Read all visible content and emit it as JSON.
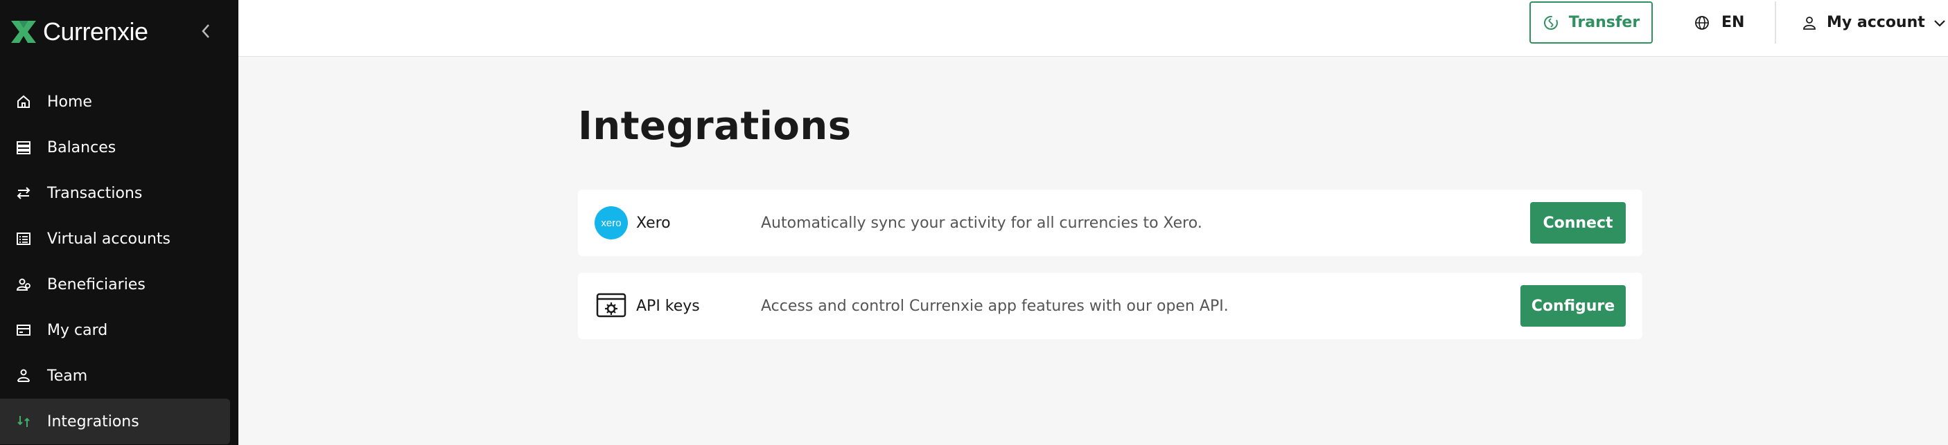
{
  "app": {
    "brand": "Currenxie",
    "colors": {
      "accent": "#2f9060",
      "sidebar": "#111111",
      "xero": "#13b5ea"
    }
  },
  "sidebar": {
    "collapse_icon": "chevron-left-icon",
    "items": [
      {
        "label": "Home",
        "icon": "home-icon",
        "active": false
      },
      {
        "label": "Balances",
        "icon": "balances-icon",
        "active": false
      },
      {
        "label": "Transactions",
        "icon": "transactions-icon",
        "active": false
      },
      {
        "label": "Virtual accounts",
        "icon": "virtual-accounts-icon",
        "active": false
      },
      {
        "label": "Beneficiaries",
        "icon": "beneficiaries-icon",
        "active": false
      },
      {
        "label": "My card",
        "icon": "card-icon",
        "active": false
      },
      {
        "label": "Team",
        "icon": "team-icon",
        "active": false
      },
      {
        "label": "Integrations",
        "icon": "integrations-icon",
        "active": true
      }
    ]
  },
  "topbar": {
    "transfer_label": "Transfer",
    "language": "EN",
    "account_label": "My account"
  },
  "main": {
    "title": "Integrations",
    "integrations": [
      {
        "logo_text": "xero",
        "name": "Xero",
        "description": "Automatically sync your activity for all currencies to Xero.",
        "action": "Connect"
      },
      {
        "name": "API keys",
        "description": "Access and control Currenxie app features with our open API.",
        "action": "Configure"
      }
    ]
  }
}
